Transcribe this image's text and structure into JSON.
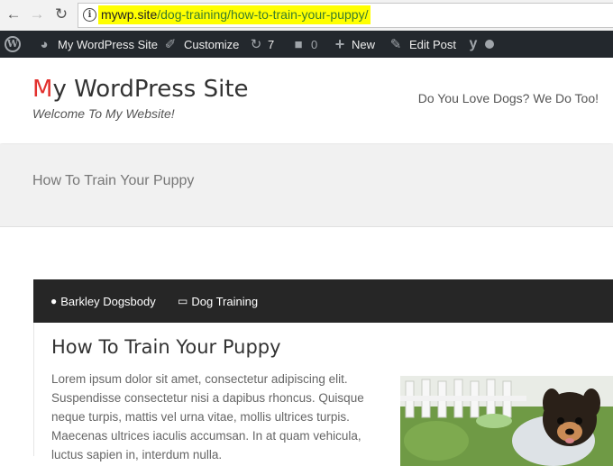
{
  "browser": {
    "url_host": "mywp.site",
    "url_path": "/dog-training/how-to-train-your-puppy/",
    "back_icon": "back-arrow-icon",
    "forward_icon": "forward-arrow-icon",
    "reload_icon": "reload-icon",
    "info_icon": "info-icon"
  },
  "admin_bar": {
    "site_name": "My WordPress Site",
    "customize": "Customize",
    "updates_count": "7",
    "comments_count": "0",
    "new_label": "New",
    "edit_post": "Edit Post",
    "seo_letter": "y"
  },
  "header": {
    "title_first": "M",
    "title_rest": "y WordPress Site",
    "tagline": "Welcome To My Website!",
    "menu_text": "Do You Love Dogs? We Do Too!"
  },
  "page": {
    "band_title": "How To Train Your Puppy"
  },
  "article": {
    "author": "Barkley Dogsbody",
    "category": "Dog Training",
    "title": "How To Train Your Puppy",
    "text": "Lorem ipsum dolor sit amet, consectetur adipiscing elit. Suspendisse consectetur nisi a dapibus rhoncus. Quisque neque turpis, mattis vel urna vitae, mollis ultrices turpis. Maecenas ultrices iaculis accumsan. In at quam vehicula, luctus sapien in, interdum nulla."
  },
  "colors": {
    "admin_bar": "#23282d",
    "accent_red": "#e2302d",
    "url_highlight": "#ffff00",
    "article_bar": "#262626"
  }
}
